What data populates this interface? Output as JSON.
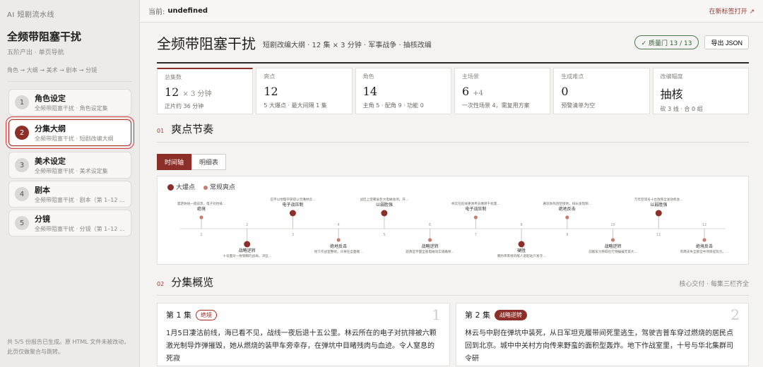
{
  "sidebar": {
    "brand": "AI 短剧流水线",
    "project_title": "全频带阻塞干扰",
    "project_sub": "五阶产出 · 单页导航",
    "flow": "角色 → 大纲 → 美术 → 剧本 → 分镜",
    "steps": [
      {
        "num": "1",
        "name": "角色设定",
        "desc": "全频带阻塞干扰 · 角色设定集"
      },
      {
        "num": "2",
        "name": "分集大纲",
        "desc": "全频带阻塞干扰 · 短剧改编大纲"
      },
      {
        "num": "3",
        "name": "美术设定",
        "desc": "全频带阻塞干扰 · 美术设定集"
      },
      {
        "num": "4",
        "name": "剧本",
        "desc": "全频带阻塞干扰 · 剧本（第 1–12 ..."
      },
      {
        "num": "5",
        "name": "分镜",
        "desc": "全频带阻塞干扰 · 分镜（第 1–12 ..."
      }
    ],
    "footer": "共 5/5 份报告已生成。原 HTML 文件未被改动，此页仅做聚合与跳转。"
  },
  "topbar": {
    "current_label": "当前:",
    "current_value": "undefined",
    "new_tab": "在新标签打开 ↗"
  },
  "hero": {
    "title": "全频带阻塞干扰",
    "subtitle": "短剧改编大纲 · 12 集 × 3 分钟 · 军事战争 · 抽核改编",
    "quality": "✓ 质量门 13 / 13",
    "export": "导出 JSON"
  },
  "stats": [
    {
      "label": "总集数",
      "value": "12",
      "suffix": "× 3 分钟",
      "detail": "正片约 36 分钟"
    },
    {
      "label": "爽点",
      "value": "12",
      "suffix": "",
      "detail": "5 大爆点 · 最大间隔 1 集"
    },
    {
      "label": "角色",
      "value": "14",
      "suffix": "",
      "detail": "主角 5 · 配角 9 · 功能 0"
    },
    {
      "label": "主场景",
      "value": "6",
      "suffix": "+4",
      "detail": "一次性场景 4，需复用方案"
    },
    {
      "label": "生成难点",
      "value": "0",
      "suffix": "",
      "detail": "预警清单为空"
    },
    {
      "label": "改编幅度",
      "value": "抽核",
      "suffix": "",
      "detail": "砍 3 线 · 合 0 组"
    }
  ],
  "section1": {
    "num": "01",
    "title": "爽点节奏",
    "tabs": [
      "时间轴",
      "明细表"
    ]
  },
  "timeline": {
    "legend_big": "大爆点",
    "legend_small": "常规爽点",
    "points": [
      {
        "ep": "1",
        "big": false,
        "above": true,
        "title": "绝境",
        "desc": "漫游防线一夜崩溃，电子对抗排..."
      },
      {
        "ep": "2",
        "big": true,
        "above": false,
        "title": "战略逆转",
        "desc": "十号面对一枚钢钢的战局，决压..."
      },
      {
        "ep": "3",
        "big": true,
        "above": true,
        "title": "电子战压制",
        "desc": "庄宇以地理学获得公元嘴林云..."
      },
      {
        "ep": "4",
        "big": false,
        "above": false,
        "title": "绝地反击",
        "desc": "地下作战室整顿，众将在全面瘫..."
      },
      {
        "ep": "5",
        "big": true,
        "above": true,
        "title": "以弱胜强",
        "desc": "战区上空雾层巨大电磁会闭。开..."
      },
      {
        "ep": "6",
        "big": false,
        "above": false,
        "title": "战略逆转",
        "desc": "骁勇官字面全部电磁攻实观确保..."
      },
      {
        "ep": "7",
        "big": false,
        "above": true,
        "title": "电子战压制",
        "desc": "林云在前线重弹吊去缠转干扰量..."
      },
      {
        "ep": "8",
        "big": true,
        "above": false,
        "title": "硬胜",
        "desc": "重防审率接的敌人退起站只发守..."
      },
      {
        "ep": "9",
        "big": false,
        "above": true,
        "title": "绝地反击",
        "desc": "著双防热烧空接地，排长发现频..."
      },
      {
        "ep": "10",
        "big": false,
        "above": false,
        "title": "战略逆转",
        "desc": "前敌军力移取社行预编编无第大..."
      },
      {
        "ep": "11",
        "big": true,
        "above": true,
        "title": "以弱胜强",
        "desc": "万年空常号十台放阵全发动机会..."
      },
      {
        "ep": "12",
        "big": false,
        "above": false,
        "title": "绝境反击",
        "desc": "有两夫失全部全中项目提及力，..."
      }
    ]
  },
  "section2": {
    "num": "02",
    "title": "分集概览",
    "right": "核心交付 · 每集三栏齐全"
  },
  "episodes": [
    {
      "label": "第 1 集",
      "tag": "绝境",
      "big": "1",
      "text": "1月5日凄沽前线，海已看不见，战线一夜后退十五公里。林云所在的电子对抗排被六颗激光制导炸弹摧毁，她从燃烧的装甲车旁幸存，在弹坑中目睹残肉与血迹。令人窒息的死寂"
    },
    {
      "label": "第 2 集",
      "tag": "战略逆转",
      "big": "2",
      "text": "林云与中尉在弹坑中装死，从日军坦克履带间死里逃生，驾驶吉普车穿过燃烧的居民点回到北京。城中中关村方向传来野蛮的面积型轰炸。地下作战室里，十号与华北集群司令研"
    }
  ],
  "colors": {
    "accent": "#8c2f28",
    "quality": "#2f5e37"
  }
}
